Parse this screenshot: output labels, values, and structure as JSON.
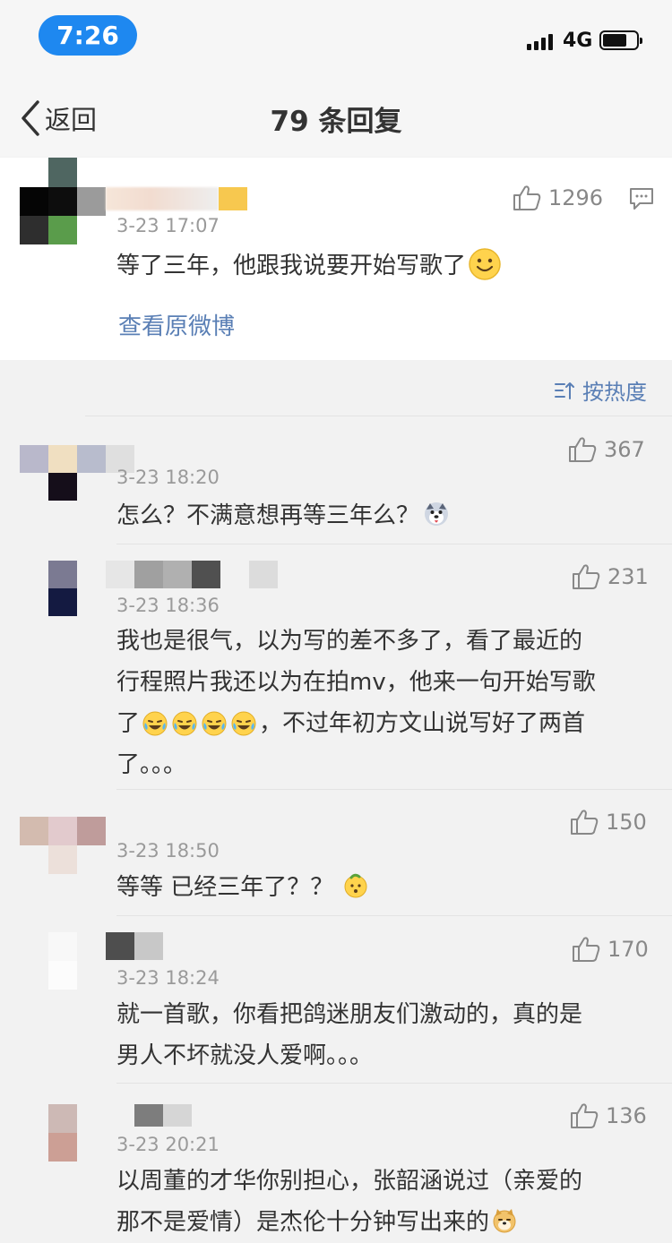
{
  "status_bar": {
    "time": "7:26",
    "network": "4G"
  },
  "nav": {
    "back_label": "返回",
    "title": "79 条回复"
  },
  "original_post": {
    "date": "3-23 17:07",
    "text": "等了三年，他跟我说要开始写歌了",
    "likes": "1296",
    "view_link": "查看原微博"
  },
  "sort": {
    "label": "按热度"
  },
  "replies": [
    {
      "date": "3-23 18:20",
      "text": "怎么？不满意想再等三年么？",
      "likes": "367"
    },
    {
      "date": "3-23 18:36",
      "line1": "我也是很气，以为写的差不多了，看了最近的",
      "line2": "行程照片我还以为在拍mv，他来一句开始写歌",
      "line3a": "了",
      "line3b": "，不过年初方文山说写好了两首",
      "line4": "了。。。",
      "likes": "231"
    },
    {
      "date": "3-23 18:50",
      "text": "等等 已经三年了？？",
      "likes": "150"
    },
    {
      "date": "3-23 18:24",
      "line1": "就一首歌，你看把鸽迷朋友们激动的，真的是",
      "line2": "男人不坏就没人爱啊。。。",
      "likes": "170"
    },
    {
      "date": "3-23 20:21",
      "line1": "以周董的才华你别担心，张韶涵说过（亲爱的",
      "line2": "那不是爱情）是杰伦十分钟写出来的",
      "likes": "136"
    }
  ],
  "colors": {
    "accent_blue": "#5a7fb5",
    "time_pill": "#1e88f0",
    "background": "#f2f2f2"
  }
}
